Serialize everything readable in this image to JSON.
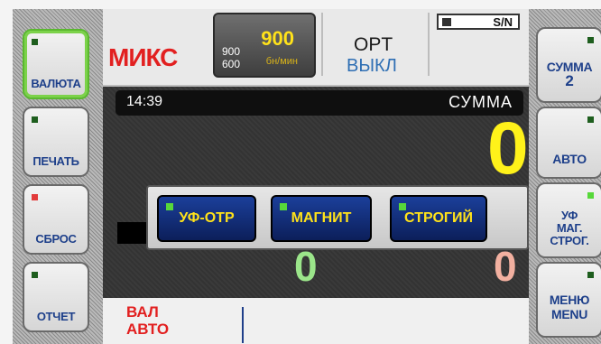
{
  "left_buttons": [
    {
      "label": "ВАЛЮТА",
      "led": "green"
    },
    {
      "label": "ПЕЧАТЬ",
      "led": "green"
    },
    {
      "label": "СБРОС",
      "led": "red"
    },
    {
      "label": "ОТЧЕТ",
      "led": "green"
    }
  ],
  "right_buttons": [
    {
      "label_line1": "СУММА",
      "label_line2": "2"
    },
    {
      "label_line1": "АВТО",
      "label_line2": ""
    },
    {
      "label_line1": "УФ",
      "label_line2": "МАГ.",
      "label_line3": "СТРОГ."
    },
    {
      "label_line1": "МЕНЮ",
      "label_line2": "MENU"
    }
  ],
  "header": {
    "mode": "МИКС",
    "speed_value": "900",
    "speed_unit": "бн/мин",
    "speed_options": [
      "900",
      "600"
    ],
    "ort_label": "OPT",
    "ort_state": "ВЫКЛ",
    "sn_label": "S/N"
  },
  "display": {
    "time": "14:39",
    "sum_label": "СУММА",
    "main_count": "0",
    "left_count": "0",
    "right_count": "0"
  },
  "popup": {
    "buttons": [
      "УФ-ОТР",
      "МАГНИТ",
      "СТРОГИЙ"
    ]
  },
  "footer": {
    "line1": "ВАЛ",
    "line2": "АВТО"
  },
  "colors": {
    "accent_red": "#e22020",
    "accent_yellow": "#ffe21a",
    "led_green": "#57d83a",
    "button_blue": "#1d3f8a"
  }
}
